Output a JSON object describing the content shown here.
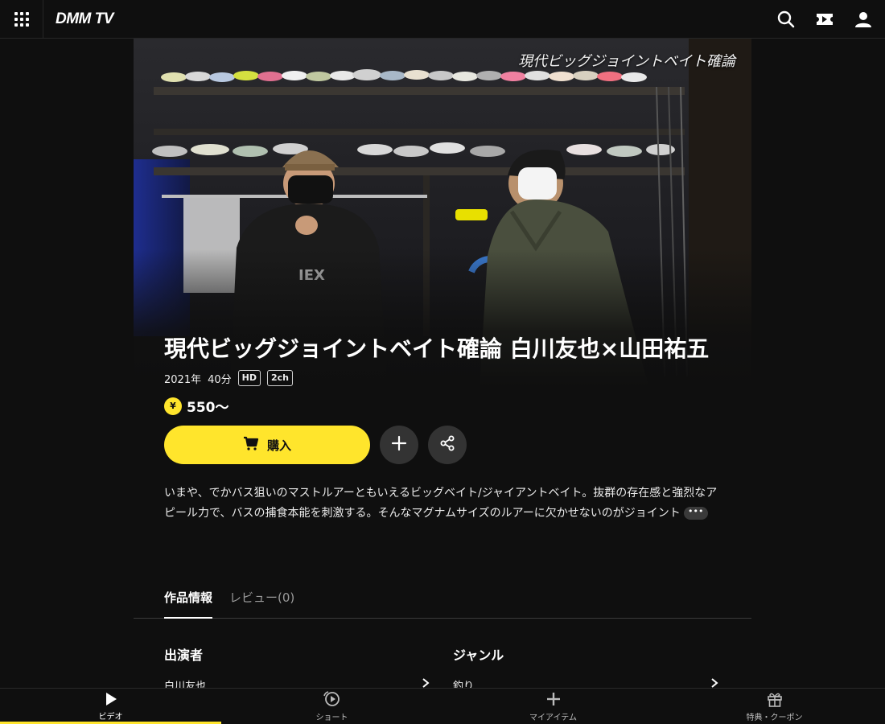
{
  "header": {
    "logo": "DMM TV",
    "icons": [
      "menu-grid-icon",
      "search-icon",
      "ticket-icon",
      "user-icon"
    ]
  },
  "hero": {
    "overlay_title": "現代ビッグジョイントベイト確論"
  },
  "title": "現代ビッグジョイントベイト確論 白川友也×山田祐五",
  "meta": {
    "year": "2021年",
    "duration": "40分",
    "badges": [
      "HD",
      "2ch"
    ]
  },
  "price": {
    "symbol": "¥",
    "value": "550〜"
  },
  "actions": {
    "buy_label": "購入",
    "icons": [
      "cart-icon",
      "plus-icon",
      "share-icon"
    ]
  },
  "description": {
    "text": "いまや、でかバス狙いのマストルアーともいえるビッグベイト/ジャイアントベイト。抜群の存在感と強烈なアピール力で、バスの捕食本能を刺激する。そんなマグナムサイズのルアーに欠かせないのがジョイント",
    "more": "•••"
  },
  "tabs": [
    {
      "label": "作品情報",
      "active": true
    },
    {
      "label": "レビュー(0)",
      "active": false
    }
  ],
  "info": {
    "cast_heading": "出演者",
    "cast": [
      "白川友也"
    ],
    "genre_heading": "ジャンル",
    "genres": [
      "釣り"
    ]
  },
  "bottom_nav": [
    {
      "label": "ビデオ",
      "icon": "play-icon",
      "active": true
    },
    {
      "label": "ショート",
      "icon": "short-icon",
      "active": false
    },
    {
      "label": "マイアイテム",
      "icon": "plus-icon",
      "active": false
    },
    {
      "label": "特典・クーポン",
      "icon": "gift-icon",
      "active": false
    }
  ],
  "colors": {
    "accent": "#ffe52c",
    "background": "#0f0f0f"
  }
}
